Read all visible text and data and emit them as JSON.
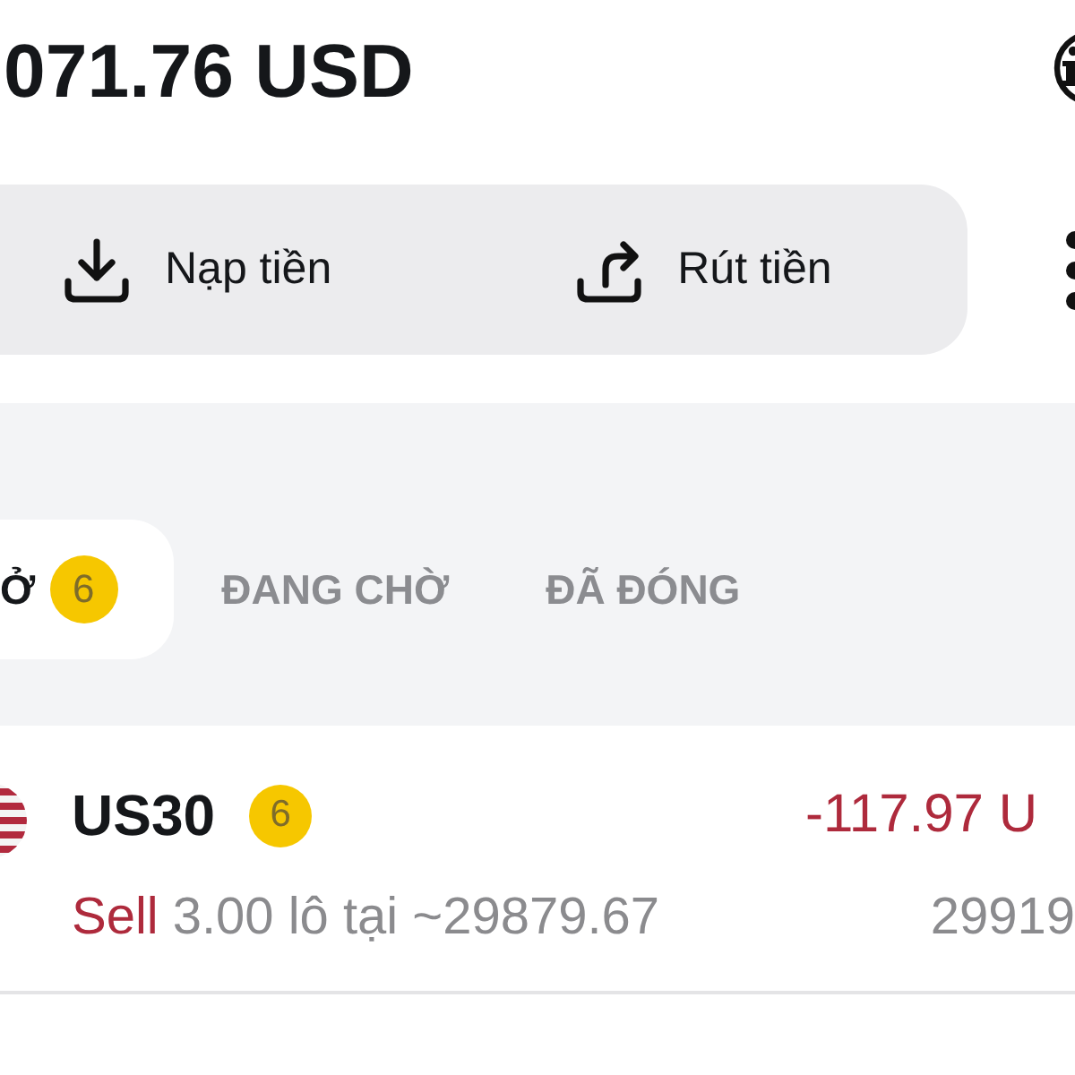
{
  "balance": {
    "amount": "071.76 USD"
  },
  "actions": [
    {
      "kind": "deposit",
      "label": "Nạp tiền"
    },
    {
      "kind": "withdraw",
      "label": "Rút tiền"
    }
  ],
  "tabs": [
    {
      "label": "Ở",
      "badge": "6",
      "selected": true
    },
    {
      "label": "ĐANG CHỜ",
      "selected": false
    },
    {
      "label": "ĐÃ ĐÓNG",
      "selected": false
    }
  ],
  "positions": [
    {
      "symbol": "US30",
      "badge": "6",
      "kind": "sell",
      "side": "Sell",
      "details": "3.00 lô tại ~29879.67",
      "profit": "-117.97 U",
      "loss": true,
      "price": "29919"
    }
  ]
}
